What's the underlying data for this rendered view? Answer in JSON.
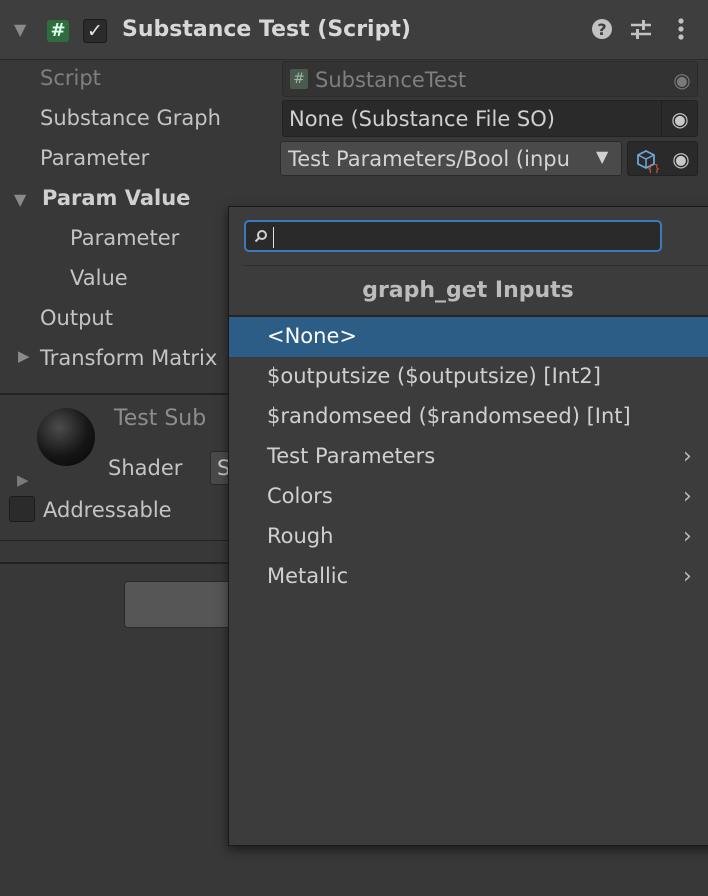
{
  "component": {
    "title": "Substance Test (Script)",
    "enabled_checkmark": "✓",
    "hash_glyph": "#"
  },
  "fields": {
    "script_label": "Script",
    "script_value": "SubstanceTest",
    "graph_label": "Substance Graph",
    "graph_value": "None (Substance File SO)",
    "parameter_label": "Parameter",
    "parameter_value": "Test Parameters/Bool (inpu",
    "param_value_label": "Param Value",
    "param_value_parameter_label": "Parameter",
    "param_value_value_label": "Value",
    "output_label": "Output",
    "transform_label": "Transform Matrix"
  },
  "material": {
    "name": "Test Sub",
    "shader_label": "Shader",
    "shader_value": "S",
    "addressable_label": "Addressable"
  },
  "dropdown": {
    "search_value": "",
    "title": "graph_get Inputs",
    "items": [
      {
        "label": "<None>",
        "selected": true,
        "has_submenu": false
      },
      {
        "label": "$outputsize ($outputsize) [Int2]",
        "selected": false,
        "has_submenu": false
      },
      {
        "label": "$randomseed ($randomseed) [Int]",
        "selected": false,
        "has_submenu": false
      },
      {
        "label": "Test Parameters",
        "selected": false,
        "has_submenu": true
      },
      {
        "label": "Colors",
        "selected": false,
        "has_submenu": true
      },
      {
        "label": "Rough",
        "selected": false,
        "has_submenu": true
      },
      {
        "label": "Metallic",
        "selected": false,
        "has_submenu": true
      }
    ]
  },
  "icons": [
    "foldout-arrow-icon",
    "script-icon",
    "help-icon",
    "settings-sliders-icon",
    "kebab-menu-icon",
    "object-picker-icon",
    "search-icon",
    "submenu-chevron-icon"
  ],
  "colors": {
    "selection": "#2c5d87",
    "search_focus": "#3a79bb",
    "background": "#383838"
  }
}
